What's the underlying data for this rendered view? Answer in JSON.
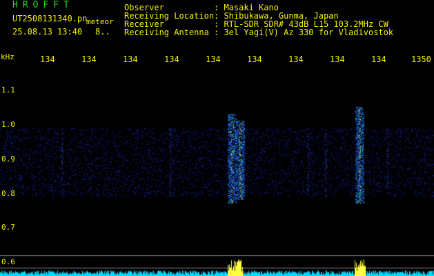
{
  "header": {
    "title": "HROFFT",
    "filename": "UT2508131340.pn",
    "file_suffix": "meteor",
    "datetime": "25.08.13 13:40",
    "count": "8..",
    "fields": [
      {
        "label": "Observer",
        "value": ": Masaki Kano"
      },
      {
        "label": "Receiving Location",
        "value": ": Shibukawa, Gunma, Japan"
      },
      {
        "label": "Receiver",
        "value": ": RTL-SDR SDR# 43dB L15 103.2MHz CW"
      },
      {
        "label": "Receiving Antenna",
        "value": ": 3el Yagi(V) Az 330 for Vladivostok"
      }
    ]
  },
  "freq_axis": {
    "unit": "kHz",
    "labels": [
      "134",
      "134",
      "134",
      "134",
      "134",
      "134",
      "134",
      "134",
      "134",
      "1350"
    ]
  },
  "y_axis": {
    "labels": [
      "1.1",
      "1.0",
      "0.9",
      "0.8",
      "0.7",
      "0.6"
    ]
  },
  "colors": {
    "text_yellow": "#f2f200",
    "title_green": "#20e020",
    "spectrum_blue": "#1a2cff",
    "echo_cyan": "#00e0ff",
    "level_yellow": "#ffff40"
  }
}
